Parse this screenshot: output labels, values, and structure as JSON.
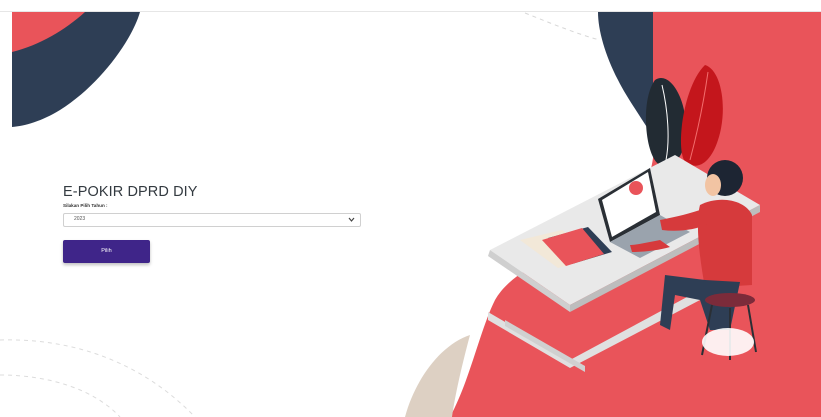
{
  "app": {
    "title": "E-POKIR DPRD DIY"
  },
  "form": {
    "year_label": "Silakan Pilih Tahun :",
    "year_selected": "2023",
    "submit_label": "Pilih"
  },
  "colors": {
    "accent_red": "#e9545a",
    "navy": "#2e3e55",
    "button": "#3f2589",
    "beige": "#ddd0c3"
  },
  "illustration": {
    "icons": [
      "person-at-laptop-illustration",
      "plant-leaf-icon",
      "laptop-icon",
      "stool-icon"
    ]
  }
}
